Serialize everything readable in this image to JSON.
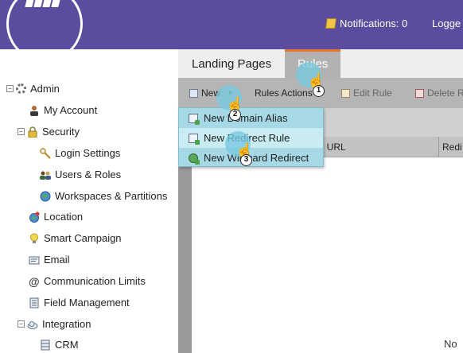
{
  "header": {
    "notifications_label": "Notifications: 0",
    "user_menu_label": "Logge",
    "brand_color": "#5c4c9f"
  },
  "sidebar": {
    "items": [
      {
        "label": "Admin",
        "icon": "gear-icon",
        "expanded": true
      },
      {
        "label": "My Account",
        "icon": "person-icon"
      },
      {
        "label": "Security",
        "icon": "lock-icon",
        "expanded": true
      },
      {
        "label": "Login Settings",
        "icon": "key-icon"
      },
      {
        "label": "Users & Roles",
        "icon": "users-icon"
      },
      {
        "label": "Workspaces & Partitions",
        "icon": "globe-icon"
      },
      {
        "label": "Location",
        "icon": "globe-pin-icon"
      },
      {
        "label": "Smart Campaign",
        "icon": "lightbulb-icon"
      },
      {
        "label": "Email",
        "icon": "email-icon"
      },
      {
        "label": "Communication Limits",
        "icon": "at-icon"
      },
      {
        "label": "Field Management",
        "icon": "field-icon"
      },
      {
        "label": "Integration",
        "icon": "cloud-icon",
        "expanded": true
      },
      {
        "label": "CRM",
        "icon": "database-icon"
      }
    ]
  },
  "tabs": [
    {
      "label": "Landing Pages",
      "active": false
    },
    {
      "label": "Rules",
      "active": true
    }
  ],
  "toolbar": {
    "new_label": "New",
    "rules_actions_label": "Rules Actions",
    "edit_rule_label": "Edit Rule",
    "delete_label": "Delete R"
  },
  "dropdown": {
    "items": [
      {
        "label": "New Domain Alias",
        "highlighted": false
      },
      {
        "label": "New Redirect Rule",
        "highlighted": true
      },
      {
        "label": "New Wildcard Redirect",
        "highlighted": false
      }
    ]
  },
  "grid": {
    "columns": [
      "Original URL",
      "Redi"
    ],
    "empty_text": "No"
  },
  "steps": [
    "1",
    "2",
    "3"
  ],
  "colors": {
    "accent_tab": "#e5762c",
    "menu_bg": "#a6d8e5",
    "step_circle": "#78c8e1"
  }
}
